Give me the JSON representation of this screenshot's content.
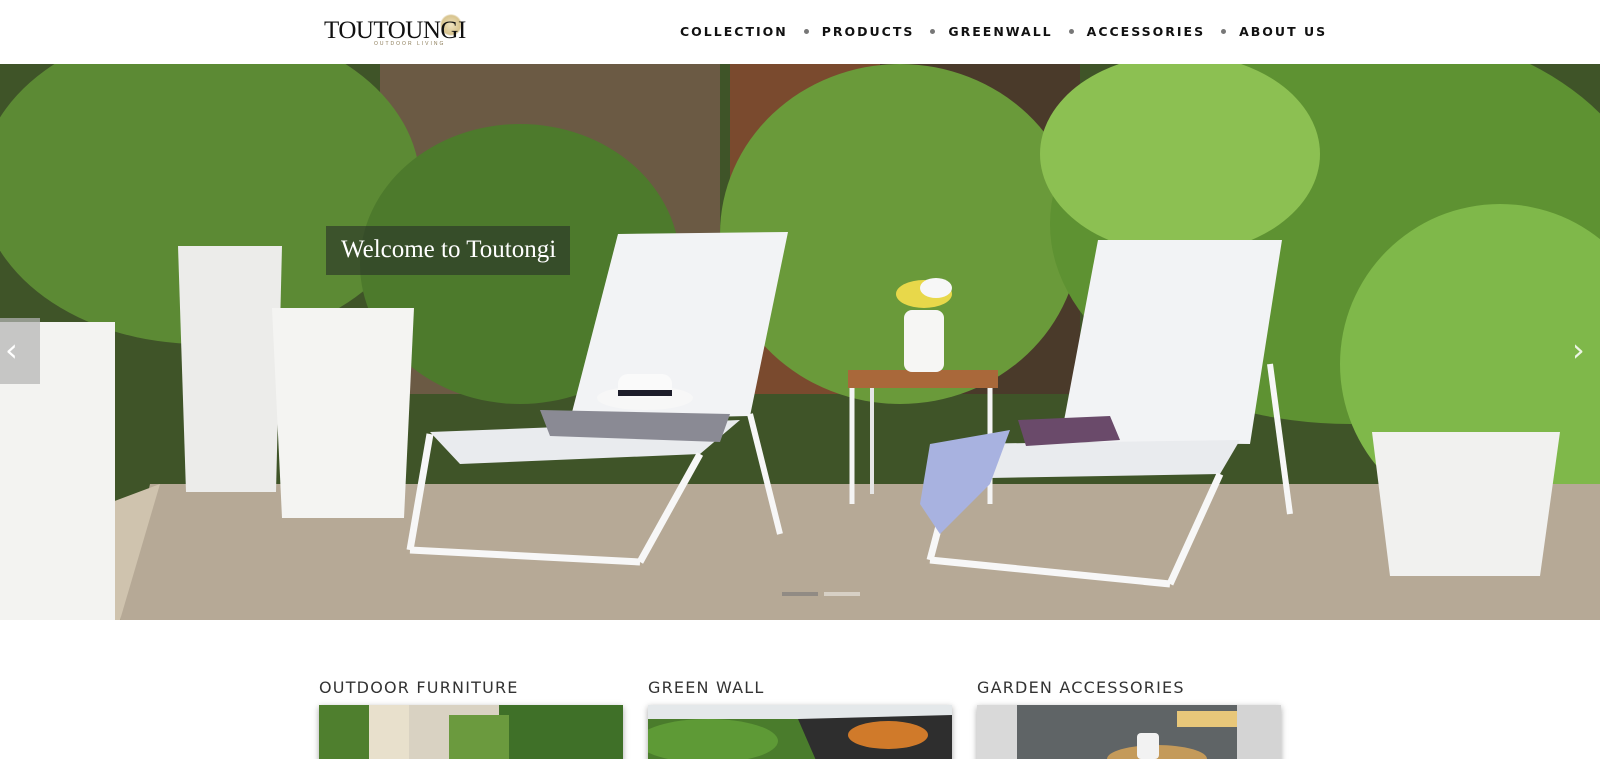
{
  "logo": {
    "name": "TOUTOUNGI",
    "tagline": "OUTDOOR LIVING"
  },
  "nav": {
    "items": [
      {
        "label": "COLLECTION"
      },
      {
        "label": "PRODUCTS"
      },
      {
        "label": "GREENWALL"
      },
      {
        "label": "ACCESSORIES"
      },
      {
        "label": "ABOUT US"
      }
    ]
  },
  "hero": {
    "caption": "Welcome to Toutongi",
    "prev_icon": "chevron-left-icon",
    "next_icon": "chevron-right-icon",
    "prev_glyph": "‹",
    "next_glyph": "›",
    "slide_count": 2,
    "active_slide": 1
  },
  "categories": [
    {
      "title": "OUTDOOR FURNITURE"
    },
    {
      "title": "GREEN WALL"
    },
    {
      "title": "GARDEN ACCESSORIES"
    }
  ],
  "colors": {
    "nav_text": "#111111",
    "caption_bg": "#283228",
    "accent_gold": "#d8c48e"
  }
}
